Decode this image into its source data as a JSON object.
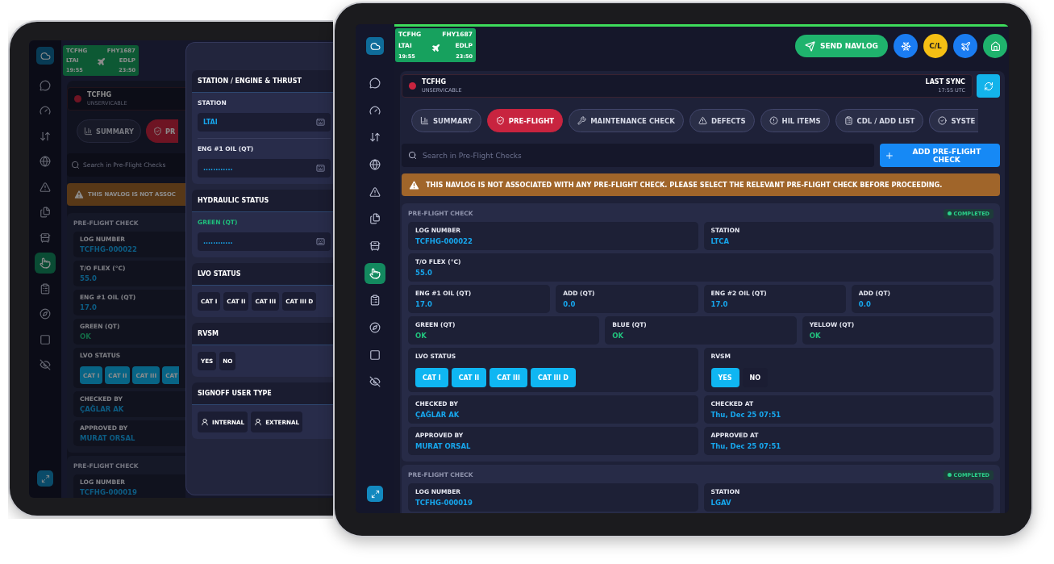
{
  "back_tablet": {
    "sidebar": {
      "items": [
        {
          "selected": false
        },
        {
          "selected": false
        },
        {
          "selected": false
        },
        {
          "selected": false
        },
        {
          "selected": false
        },
        {
          "selected": false
        },
        {
          "selected": false
        },
        {
          "selected": true
        },
        {
          "selected": false
        },
        {
          "selected": false
        },
        {
          "selected": false
        },
        {
          "selected": false
        }
      ]
    },
    "flight": {
      "aircraft": "TCFHG",
      "flight_no": "FHY1687",
      "from": "LTAI",
      "to": "EDLP",
      "departure": "19:55",
      "arrival": "23:50"
    },
    "aircraft_status": {
      "registration": "TCFHG",
      "state": "UNSERVICABLE",
      "serviceable": false
    },
    "tabs": [
      {
        "kind": "summary",
        "label": "SUMMARY",
        "selected": false
      },
      {
        "kind": "preflight",
        "label": "PR",
        "selected": true
      }
    ],
    "search": {
      "placeholder": "Search in Pre-Flight Checks"
    },
    "warning": "THIS NAVLOG IS NOT ASSOC",
    "checks": [
      {
        "title": "PRE-FLIGHT CHECK",
        "lines": [
          {
            "fields": [
              {
                "kind": "text",
                "label": "LOG NUMBER",
                "value": "TCFHG-000022"
              }
            ]
          },
          {
            "fields": [
              {
                "kind": "text",
                "label": "T/O FLEX (°C)",
                "value": "55.0"
              }
            ]
          },
          {
            "fields": [
              {
                "kind": "text",
                "label": "ENG #1 OIL (QT)",
                "value": "17.0"
              }
            ]
          },
          {
            "fields": [
              {
                "kind": "ok",
                "label": "GREEN (QT)",
                "value": "OK"
              }
            ]
          },
          {
            "fields": [
              {
                "kind": "options",
                "label": "LVO STATUS",
                "options": [
                  {
                    "label": "CAT I",
                    "selected": true
                  },
                  {
                    "label": "CAT II",
                    "selected": true
                  },
                  {
                    "label": "CAT III",
                    "selected": true
                  },
                  {
                    "label": "CAT",
                    "selected": true
                  }
                ]
              }
            ]
          },
          {
            "fields": [
              {
                "kind": "text",
                "label": "CHECKED BY",
                "value": "ÇAĞLAR AK"
              }
            ]
          },
          {
            "fields": [
              {
                "kind": "text",
                "label": "APPROVED BY",
                "value": "MURAT ORSAL"
              }
            ]
          }
        ]
      },
      {
        "title": "PRE-FLIGHT CHECK",
        "lines": [
          {
            "fields": [
              {
                "kind": "text",
                "label": "LOG NUMBER",
                "value": "TCFHG-000019"
              }
            ]
          }
        ]
      }
    ],
    "drawer": {
      "sections": [
        {
          "title": "STATION / ENGINE & THRUST",
          "items": [
            {
              "kind": "input",
              "label": "STATION",
              "value": "LTAI",
              "accent": false
            },
            {
              "kind": "input",
              "label": "ENG #1 OIL (QT)",
              "placeholder": "............",
              "accent": false
            }
          ]
        },
        {
          "title": "HYDRAULIC STATUS",
          "items": [
            {
              "kind": "input",
              "label": "GREEN (QT)",
              "placeholder": "............",
              "accent": true
            }
          ]
        },
        {
          "title": "LVO STATUS",
          "items": [
            {
              "kind": "options",
              "options": [
                {
                  "label": "CAT I",
                  "selected": false
                },
                {
                  "label": "CAT II",
                  "selected": false
                },
                {
                  "label": "CAT III",
                  "selected": false
                },
                {
                  "label": "CAT III D",
                  "selected": false
                }
              ]
            }
          ]
        },
        {
          "title": "RVSM",
          "items": [
            {
              "kind": "options",
              "options": [
                {
                  "label": "YES",
                  "selected": false
                },
                {
                  "label": "NO",
                  "selected": false
                }
              ]
            }
          ]
        },
        {
          "title": "SIGNOFF USER TYPE",
          "items": [
            {
              "kind": "user_types",
              "options": [
                {
                  "label": "INTERNAL",
                  "selected": false
                },
                {
                  "label": "EXTERNAL",
                  "selected": false
                }
              ]
            }
          ]
        }
      ]
    }
  },
  "front_tablet": {
    "sidebar": {
      "items": [
        {
          "selected": false
        },
        {
          "selected": false
        },
        {
          "selected": false
        },
        {
          "selected": false
        },
        {
          "selected": false
        },
        {
          "selected": false
        },
        {
          "selected": false
        },
        {
          "selected": true
        },
        {
          "selected": false
        },
        {
          "selected": false
        },
        {
          "selected": false
        },
        {
          "selected": false
        }
      ]
    },
    "flight": {
      "aircraft": "TCFHG",
      "flight_no": "FHY1687",
      "from": "LTAI",
      "to": "EDLP",
      "departure": "19:55",
      "arrival": "23:50"
    },
    "actions": [
      {
        "kind": "send",
        "label": "SEND NAVLOG"
      },
      {
        "kind": "snowflake"
      },
      {
        "kind": "checklist",
        "label": "C/L"
      },
      {
        "kind": "plane"
      },
      {
        "kind": "home"
      }
    ],
    "aircraft_status": {
      "registration": "TCFHG",
      "state": "UNSERVICABLE",
      "serviceable": false
    },
    "last_sync": {
      "label": "LAST SYNC",
      "time": "17:55 UTC"
    },
    "tabs": [
      {
        "kind": "summary",
        "label": "SUMMARY",
        "selected": false
      },
      {
        "kind": "preflight",
        "label": "PRE-FLIGHT",
        "selected": true
      },
      {
        "kind": "maintenance",
        "label": "MAINTENANCE CHECK",
        "selected": false
      },
      {
        "kind": "defects",
        "label": "DEFECTS",
        "selected": false
      },
      {
        "kind": "hil",
        "label": "HIL ITEMS",
        "selected": false
      },
      {
        "kind": "cdl",
        "label": "CDL / ADD LIST",
        "selected": false
      },
      {
        "kind": "systems",
        "label": "SYSTE",
        "selected": false
      }
    ],
    "search": {
      "placeholder": "Search in Pre-Flight Checks"
    },
    "add_button": "ADD PRE-FLIGHT CHECK",
    "warning": "THIS NAVLOG IS NOT ASSOCIATED WITH ANY PRE-FLIGHT CHECK. PLEASE SELECT THE RELEVANT PRE-FLIGHT CHECK BEFORE PROCEEDING.",
    "checks": [
      {
        "title": "PRE-FLIGHT CHECK",
        "status": "COMPLETED",
        "lines": [
          {
            "fields": [
              {
                "kind": "text",
                "label": "LOG NUMBER",
                "value": "TCFHG-000022"
              },
              {
                "kind": "text",
                "label": "STATION",
                "value": "LTCA"
              }
            ]
          },
          {
            "fields": [
              {
                "kind": "text",
                "label": "T/O FLEX (°C)",
                "value": "55.0"
              }
            ]
          },
          {
            "fields": [
              {
                "kind": "text",
                "label": "ENG #1 OIL (QT)",
                "value": "17.0"
              },
              {
                "kind": "text",
                "label": "ADD (QT)",
                "value": "0.0"
              },
              {
                "kind": "text",
                "label": "ENG #2 OIL (QT)",
                "value": "17.0"
              },
              {
                "kind": "text",
                "label": "ADD (QT)",
                "value": "0.0"
              }
            ]
          },
          {
            "fields": [
              {
                "kind": "ok",
                "label": "GREEN (QT)",
                "value": "OK"
              },
              {
                "kind": "ok",
                "label": "BLUE (QT)",
                "value": "OK"
              },
              {
                "kind": "ok",
                "label": "YELLOW (QT)",
                "value": "OK"
              }
            ]
          },
          {
            "fields": [
              {
                "kind": "options",
                "label": "LVO STATUS",
                "options": [
                  {
                    "label": "CAT I",
                    "selected": true
                  },
                  {
                    "label": "CAT II",
                    "selected": true
                  },
                  {
                    "label": "CAT III",
                    "selected": true
                  },
                  {
                    "label": "CAT III D",
                    "selected": true
                  }
                ]
              },
              {
                "kind": "options",
                "label": "RVSM",
                "options": [
                  {
                    "label": "YES",
                    "selected": true
                  },
                  {
                    "label": "NO",
                    "selected": false
                  }
                ]
              }
            ]
          },
          {
            "fields": [
              {
                "kind": "text",
                "label": "CHECKED BY",
                "value": "ÇAĞLAR AK"
              },
              {
                "kind": "text",
                "label": "CHECKED AT",
                "value": "Thu, Dec 25 07:51"
              }
            ]
          },
          {
            "fields": [
              {
                "kind": "text",
                "label": "APPROVED BY",
                "value": "MURAT ORSAL"
              },
              {
                "kind": "text",
                "label": "APPROVED AT",
                "value": "Thu, Dec 25 07:51"
              }
            ]
          }
        ]
      },
      {
        "title": "PRE-FLIGHT CHECK",
        "status": "COMPLETED",
        "lines": [
          {
            "fields": [
              {
                "kind": "text",
                "label": "LOG NUMBER",
                "value": "TCFHG-000019"
              },
              {
                "kind": "text",
                "label": "STATION",
                "value": "LGAV"
              }
            ]
          }
        ]
      }
    ]
  }
}
